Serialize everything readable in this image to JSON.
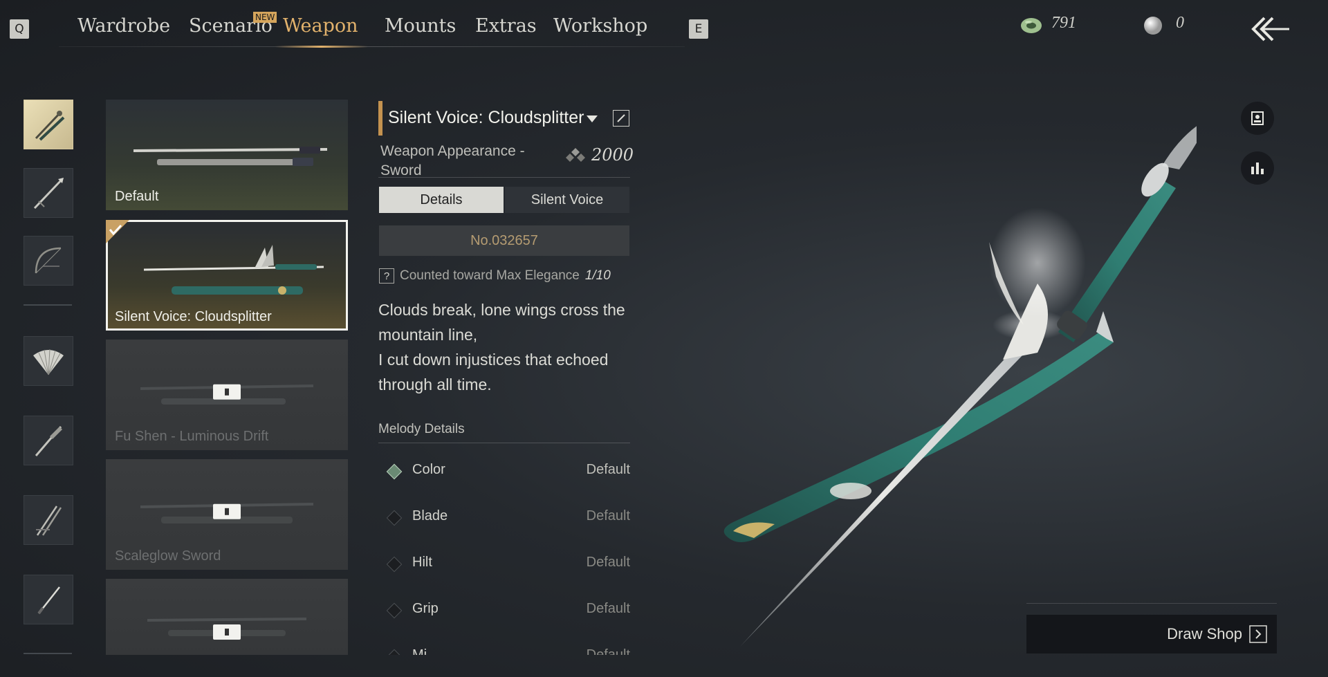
{
  "nav": {
    "left_key": "Q",
    "right_key": "E",
    "tabs": [
      {
        "label": "Wardrobe"
      },
      {
        "label": "Scenario",
        "badge": "NEW"
      },
      {
        "label": "Weapon"
      },
      {
        "label": "Mounts"
      },
      {
        "label": "Extras"
      },
      {
        "label": "Workshop"
      }
    ],
    "active_tab": "Weapon"
  },
  "currencies": [
    {
      "icon": "jade-coin-icon",
      "value": "791"
    },
    {
      "icon": "pearl-icon",
      "value": "0"
    }
  ],
  "back_icon": "back-arrow-icon",
  "categories": [
    {
      "icon": "twin-blade-icon",
      "active": true
    },
    {
      "icon": "spear-icon",
      "active": false
    },
    {
      "icon": "bow-icon",
      "active": false
    },
    {
      "icon": "fan-icon",
      "active": false
    },
    {
      "icon": "umbrella-sword-icon",
      "active": false
    },
    {
      "icon": "dual-blades-icon",
      "active": false
    },
    {
      "icon": "dagger-icon",
      "active": false
    }
  ],
  "weapons": [
    {
      "name": "Default",
      "locked": false,
      "selected": false
    },
    {
      "name": "Silent Voice: Cloudsplitter",
      "locked": false,
      "selected": true
    },
    {
      "name": "Fu Shen - Luminous Drift",
      "locked": true,
      "selected": false
    },
    {
      "name": "Scaleglow Sword",
      "locked": true,
      "selected": false
    },
    {
      "name": "",
      "locked": true,
      "selected": false
    }
  ],
  "detail": {
    "title": "Silent Voice: Cloudsplitter",
    "subtitle": "Weapon Appearance - Sword",
    "price": "2000",
    "tabs": {
      "details": "Details",
      "silent_voice": "Silent Voice"
    },
    "serial": "No.032657",
    "counted_label": "Counted toward Max Elegance",
    "counted_value": "1/10",
    "poem_lines": [
      "Clouds break, lone wings cross the mountain line,",
      "I cut down injustices that echoed through all time."
    ],
    "melody_header": "Melody Details",
    "parts": [
      {
        "name": "Color",
        "value": "Default",
        "active": true
      },
      {
        "name": "Blade",
        "value": "Default",
        "active": false
      },
      {
        "name": "Hilt",
        "value": "Default",
        "active": false
      },
      {
        "name": "Grip",
        "value": "Default",
        "active": false
      },
      {
        "name": "Mi",
        "value": "Default",
        "active": false
      }
    ]
  },
  "draw_shop": "Draw Shop"
}
